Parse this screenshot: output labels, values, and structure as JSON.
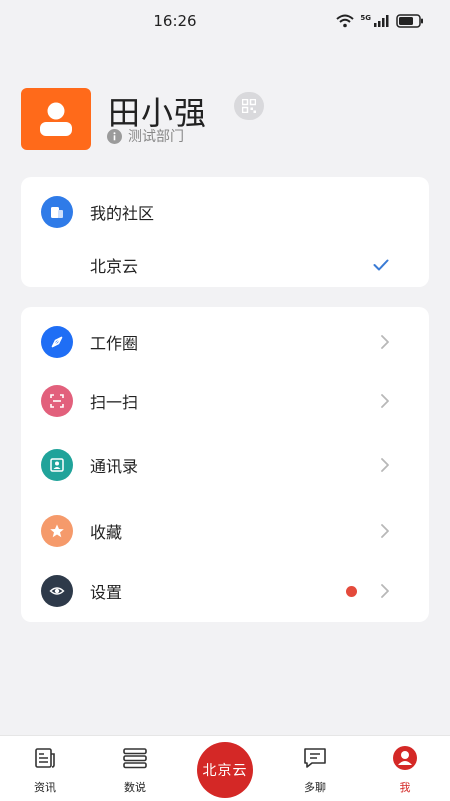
{
  "status_bar": {
    "time": "16:26",
    "network": "5G"
  },
  "profile": {
    "name": "田小强",
    "department": "测试部门"
  },
  "community": {
    "title": "我的社区",
    "selected": "北京云"
  },
  "menu": [
    {
      "label": "工作圈",
      "icon": "compass-icon",
      "color": "#1f6ef5"
    },
    {
      "label": "扫一扫",
      "icon": "scan-icon",
      "color": "#e2607c"
    },
    {
      "label": "通讯录",
      "icon": "contacts-icon",
      "color": "#20a39a"
    },
    {
      "label": "收藏",
      "icon": "star-icon",
      "color": "#f59a6b"
    },
    {
      "label": "设置",
      "icon": "settings-icon",
      "color": "#2e3a4a"
    }
  ],
  "tabs": [
    {
      "label": "资讯",
      "icon": "news-icon"
    },
    {
      "label": "数说",
      "icon": "stack-icon"
    },
    {
      "label": "北京云",
      "icon": "center-logo"
    },
    {
      "label": "多聊",
      "icon": "chat-icon"
    },
    {
      "label": "我",
      "icon": "profile-icon",
      "active": true
    }
  ],
  "colors": {
    "accent": "#d42826",
    "check": "#3a7bd5",
    "avatar_bg": "#ff6a1a"
  }
}
